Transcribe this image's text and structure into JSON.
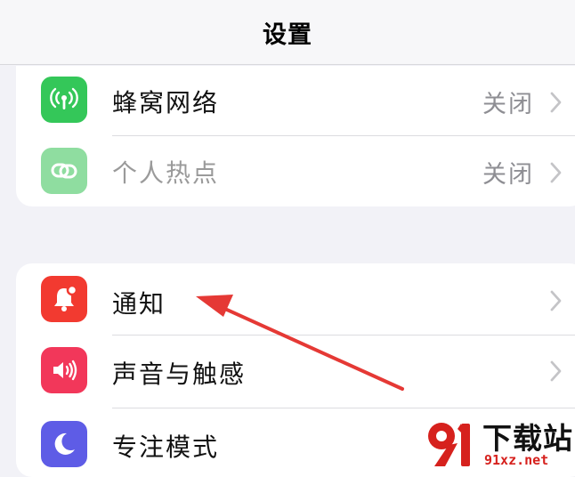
{
  "navbar": {
    "title": "设置"
  },
  "group_connectivity": {
    "cellular": {
      "label": "蜂窝网络",
      "value": "关闭",
      "icon": "antenna-icon",
      "color": "#34c759"
    },
    "hotspot": {
      "label": "个人热点",
      "value": "关闭",
      "icon": "link-icon",
      "color": "#8fdda0"
    }
  },
  "group_system": {
    "notifications": {
      "label": "通知",
      "icon": "bell-icon",
      "color": "#f23a30"
    },
    "sounds": {
      "label": "声音与触感",
      "icon": "speaker-icon",
      "color": "#f2375a"
    },
    "focus": {
      "label": "专注模式",
      "icon": "moon-icon",
      "color": "#5e5ce6"
    }
  },
  "annotation": {
    "arrow_color": "#e53935"
  },
  "watermark": {
    "title": "下载站",
    "url": "91xz.net",
    "accent": "#d6211d"
  }
}
